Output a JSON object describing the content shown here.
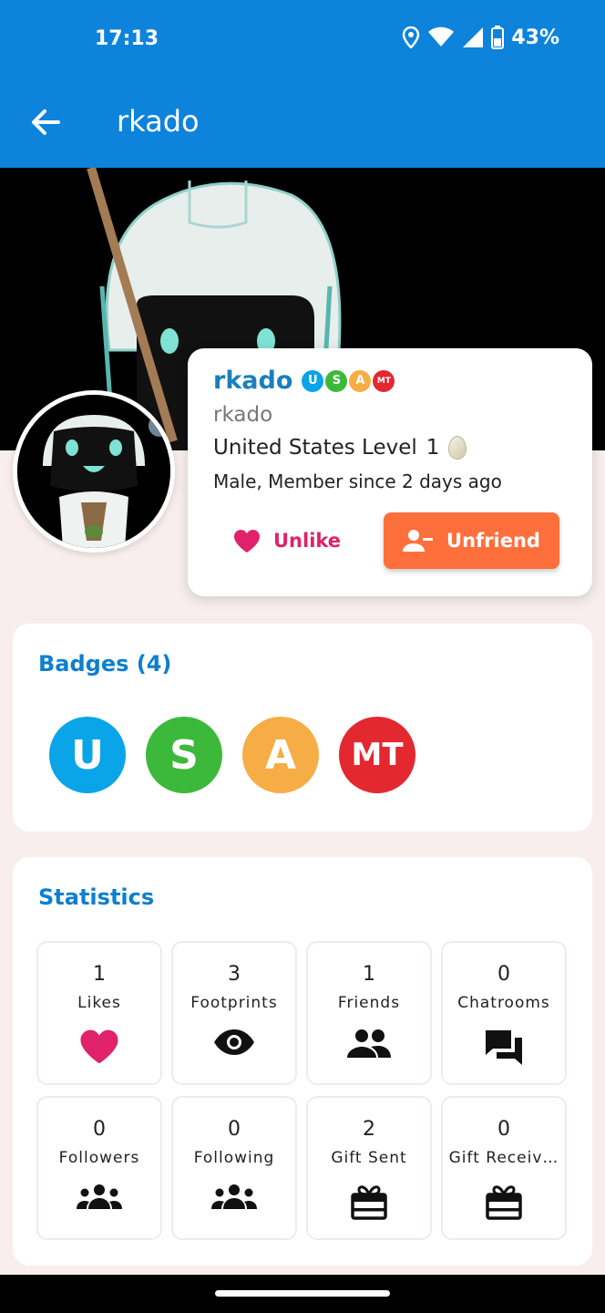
{
  "status_bar": {
    "time": "17:13",
    "battery": "43%",
    "icons": [
      "location-icon",
      "wifi-icon",
      "signal-icon",
      "battery-icon"
    ]
  },
  "app_bar": {
    "title": "rkado",
    "back_icon": "arrow-left-icon"
  },
  "profile": {
    "display_name": "rkado",
    "username": "rkado",
    "level_text": "United States Level",
    "level": "1",
    "meta": "Male, Member since 2 days ago",
    "unlike_label": "Unlike",
    "unfriend_label": "Unfriend"
  },
  "badges": {
    "title": "Badges (4)",
    "items": [
      {
        "text": "U",
        "color": "#0aa4e8"
      },
      {
        "text": "S",
        "color": "#3cb93a"
      },
      {
        "text": "A",
        "color": "#f6ad45"
      },
      {
        "text": "MT",
        "color": "#e4282f"
      }
    ]
  },
  "statistics": {
    "title": "Statistics",
    "items": [
      {
        "value": "1",
        "label": "Likes",
        "icon": "heart-icon"
      },
      {
        "value": "3",
        "label": "Footprints",
        "icon": "eye-icon"
      },
      {
        "value": "1",
        "label": "Friends",
        "icon": "people-icon"
      },
      {
        "value": "0",
        "label": "Chatrooms",
        "icon": "chat-icon"
      },
      {
        "value": "0",
        "label": "Followers",
        "icon": "groups-icon"
      },
      {
        "value": "0",
        "label": "Following",
        "icon": "groups-icon"
      },
      {
        "value": "2",
        "label": "Gift Sent",
        "icon": "gift-icon"
      },
      {
        "value": "0",
        "label": "Gift Receiv…",
        "icon": "gift-icon"
      }
    ]
  },
  "colors": {
    "primary": "#0d83dc",
    "accent_orange": "#ff6f3c",
    "like_pink": "#e0226a",
    "title_blue": "#0d7fcf"
  }
}
